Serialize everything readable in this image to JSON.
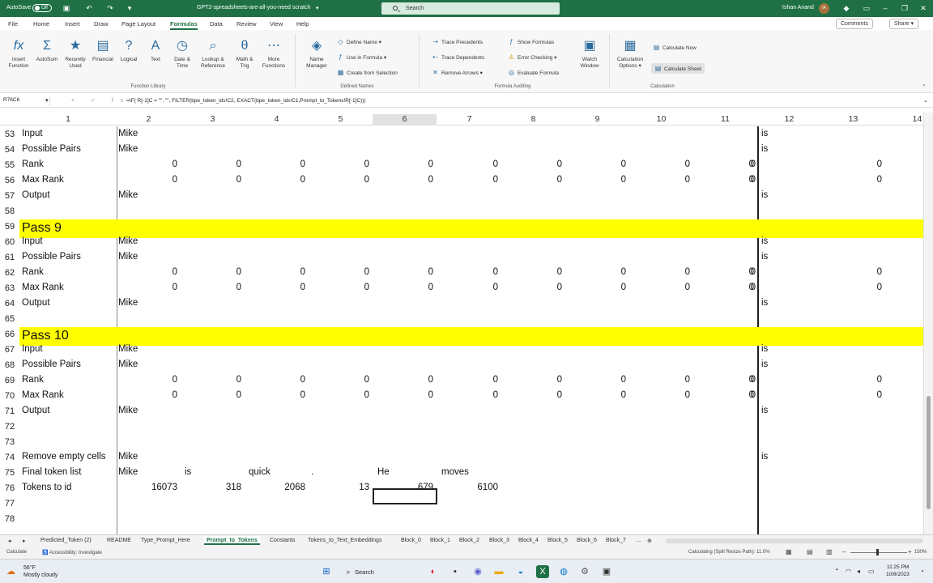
{
  "titlebar": {
    "autosave": "AutoSave",
    "autosave_state": "Off",
    "filename": "GPT2-spreadsheets-are-all-you-need scratch",
    "search_placeholder": "Search",
    "user": "Ishan Anand",
    "initials": "IA",
    "accent_color": "#1f7145"
  },
  "tabs": [
    "File",
    "Home",
    "Insert",
    "Draw",
    "Page Layout",
    "Formulas",
    "Data",
    "Review",
    "View",
    "Help"
  ],
  "active_tab": "Formulas",
  "comments_label": "Comments",
  "share_label": "Share",
  "ribbon": {
    "function_library": {
      "group": "Function Library",
      "buttons": [
        {
          "l1": "Insert",
          "l2": "Function",
          "icon": "fx-icon"
        },
        {
          "l1": "AutoSum",
          "l2": "",
          "icon": "sigma-icon"
        },
        {
          "l1": "Recently",
          "l2": "Used",
          "icon": "star-icon"
        },
        {
          "l1": "Financial",
          "l2": "",
          "icon": "book-icon"
        },
        {
          "l1": "Logical",
          "l2": "",
          "icon": "question-icon"
        },
        {
          "l1": "Text",
          "l2": "",
          "icon": "letter-a-icon"
        },
        {
          "l1": "Date &",
          "l2": "Time",
          "icon": "clock-icon"
        },
        {
          "l1": "Lookup &",
          "l2": "Reference",
          "icon": "search-book-icon"
        },
        {
          "l1": "Math &",
          "l2": "Trig",
          "icon": "theta-icon"
        },
        {
          "l1": "More",
          "l2": "Functions",
          "icon": "more-icon"
        }
      ]
    },
    "defined_names": {
      "group": "Defined Names",
      "name_manager": {
        "l1": "Name",
        "l2": "Manager"
      },
      "items": [
        "Define Name",
        "Use in Formula",
        "Create from Selection"
      ]
    },
    "formula_auditing": {
      "group": "Formula Auditing",
      "left": [
        "Trace Precedents",
        "Trace Dependents",
        "Remove Arrows"
      ],
      "right": [
        "Show Formulas",
        "Error Checking",
        "Evaluate Formula"
      ],
      "watch": {
        "l1": "Watch",
        "l2": "Window"
      }
    },
    "calculation": {
      "group": "Calculation",
      "options": {
        "l1": "Calculation",
        "l2": "Options"
      },
      "items": [
        "Calculate Now",
        "Calculate Sheet"
      ]
    }
  },
  "formula_bar": {
    "name_box": "R76C6",
    "fx": "× ✓ fx",
    "formula": "=IF( R[-1]C = \"\", \"\", FILTER(bpe_token_ids!C2, EXACT(bpe_token_ids!C1,Prompt_to_Tokens!R[-1]C)))"
  },
  "columns": [
    "1",
    "2",
    "3",
    "4",
    "5",
    "6",
    "7",
    "8",
    "9",
    "10",
    "11",
    "12",
    "13",
    "14"
  ],
  "selected_column": "6",
  "rows": [
    {
      "n": "53",
      "label": "Input",
      "c2": "Mike",
      "c12": "is"
    },
    {
      "n": "54",
      "label": "Possible Pairs",
      "c2": "Mike",
      "c12": "is"
    },
    {
      "n": "55",
      "label": "Rank",
      "nums": [
        "0",
        "0",
        "0",
        "0",
        "0",
        "0",
        "0",
        "0",
        "0",
        "0",
        "0",
        "0"
      ]
    },
    {
      "n": "56",
      "label": "Max Rank",
      "nums": [
        "0",
        "0",
        "0",
        "0",
        "0",
        "0",
        "0",
        "0",
        "0",
        "0",
        "0",
        "0"
      ]
    },
    {
      "n": "57",
      "label": "Output",
      "c2": "Mike",
      "c12": "is"
    },
    {
      "n": "58",
      "label": ""
    },
    {
      "n": "59",
      "band": "Pass 9"
    },
    {
      "n": "60",
      "label": "Input",
      "c2": "Mike",
      "c12": "is"
    },
    {
      "n": "61",
      "label": "Possible Pairs",
      "c2": "Mike",
      "c12": "is"
    },
    {
      "n": "62",
      "label": "Rank",
      "nums": [
        "0",
        "0",
        "0",
        "0",
        "0",
        "0",
        "0",
        "0",
        "0",
        "0",
        "0",
        "0"
      ]
    },
    {
      "n": "63",
      "label": "Max Rank",
      "nums": [
        "0",
        "0",
        "0",
        "0",
        "0",
        "0",
        "0",
        "0",
        "0",
        "0",
        "0",
        "0"
      ]
    },
    {
      "n": "64",
      "label": "Output",
      "c2": "Mike",
      "c12": "is"
    },
    {
      "n": "65",
      "label": ""
    },
    {
      "n": "66",
      "band": "Pass 10"
    },
    {
      "n": "67",
      "label": "Input",
      "c2": "Mike",
      "c12": "is"
    },
    {
      "n": "68",
      "label": "Possible Pairs",
      "c2": "Mike",
      "c12": "is"
    },
    {
      "n": "69",
      "label": "Rank",
      "nums": [
        "0",
        "0",
        "0",
        "0",
        "0",
        "0",
        "0",
        "0",
        "0",
        "0",
        "0",
        "0"
      ]
    },
    {
      "n": "70",
      "label": "Max Rank",
      "nums": [
        "0",
        "0",
        "0",
        "0",
        "0",
        "0",
        "0",
        "0",
        "0",
        "0",
        "0",
        "0"
      ]
    },
    {
      "n": "71",
      "label": "Output",
      "c2": "Mike",
      "c12": "is"
    },
    {
      "n": "72",
      "label": ""
    },
    {
      "n": "73",
      "label": ""
    },
    {
      "n": "74",
      "label": "Remove empty cells",
      "c2": "Mike",
      "c12": "is"
    },
    {
      "n": "75",
      "label": "Final token list",
      "texts": [
        "Mike",
        "is",
        "quick",
        ".",
        "He",
        "moves"
      ]
    },
    {
      "n": "76",
      "label": "Tokens to id",
      "ids": [
        "16073",
        "318",
        "2068",
        "13",
        "679",
        "6100"
      ]
    },
    {
      "n": "77",
      "label": ""
    },
    {
      "n": "78",
      "label": ""
    }
  ],
  "sheet_tabs": [
    "Predicted_Token (2)",
    "README",
    "Type_Prompt_Here",
    "Prompt_to_Tokens",
    "Constants",
    "Tokens_to_Text_Embeddings",
    "Block_0",
    "Block_1",
    "Block_2",
    "Block_3",
    "Block_4",
    "Block_5",
    "Block_6",
    "Block_7",
    "..."
  ],
  "active_sheet": "Prompt_to_Tokens",
  "status": {
    "mode": "Calculate",
    "accessibility": "Accessibility: Investigate",
    "calc_status": "Calculating (Spill Resize Path): 11.0%",
    "zoom": "150%"
  },
  "taskbar": {
    "weather_temp": "56°F",
    "weather_desc": "Mostly cloudy",
    "search": "Search",
    "time": "11:25 PM",
    "date": "10/8/2023"
  }
}
